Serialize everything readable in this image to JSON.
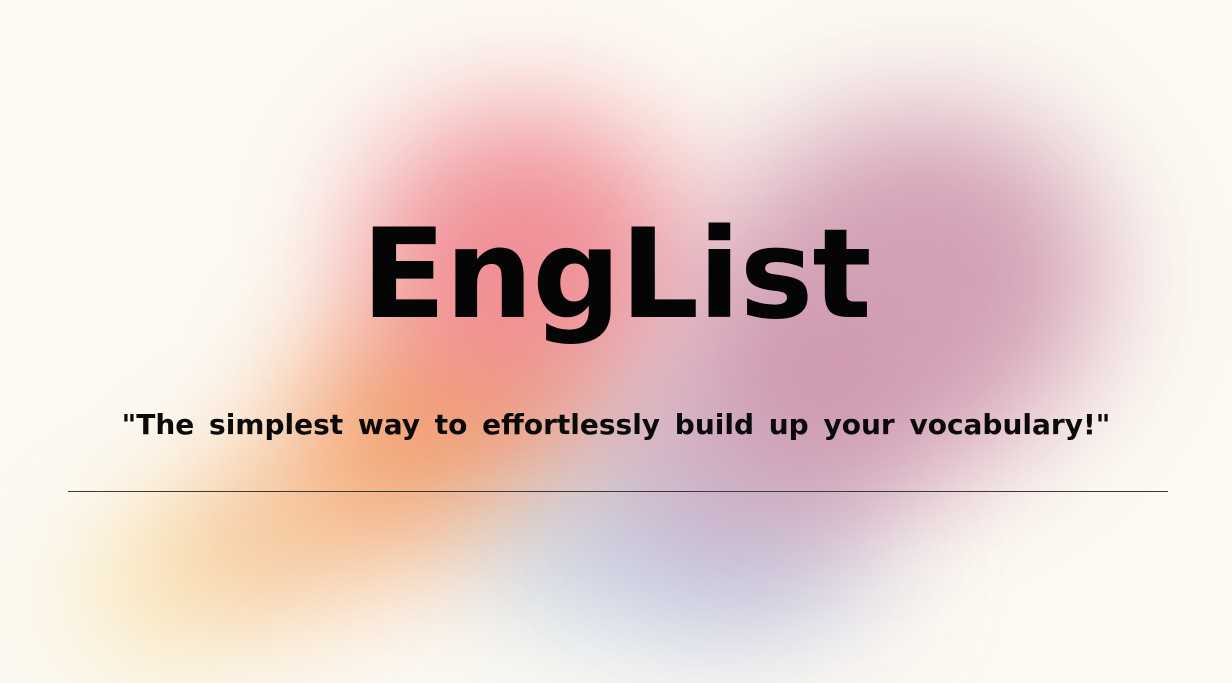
{
  "app": {
    "title": "EngList",
    "tagline": "\"The simplest way to effortlessly build up your vocabulary!\""
  },
  "colors": {
    "background": "#fcf9f2",
    "text": "#050505",
    "divider": "#3a3a3a",
    "gradient_red": "#ee7f8a",
    "gradient_orange": "#f08a4e",
    "gradient_yellow": "#f7d98c",
    "gradient_purple": "#c98aa6",
    "gradient_blue": "#b8cde6"
  }
}
